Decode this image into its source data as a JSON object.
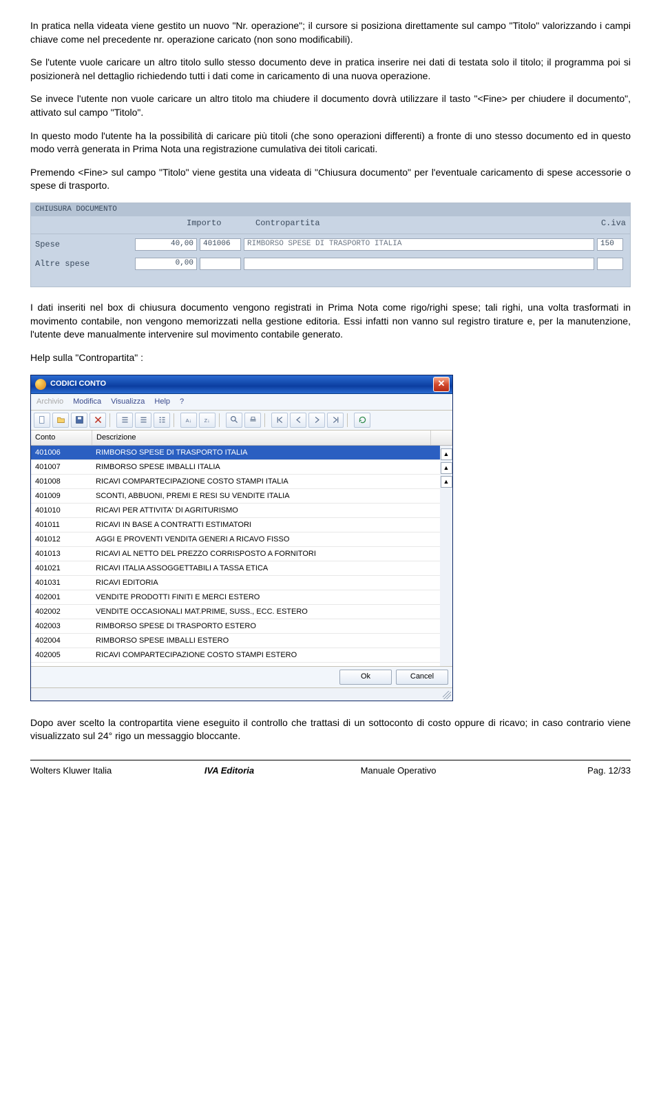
{
  "paragraphs": {
    "p1": "In pratica nella videata viene gestito un nuovo \"Nr. operazione\"; il cursore si posiziona direttamente sul campo \"Titolo\" valorizzando i campi chiave come nel precedente nr. operazione caricato (non sono modificabili).",
    "p2": "Se l'utente vuole caricare un altro titolo sullo stesso documento deve in pratica inserire nei dati di testata solo il titolo; il programma poi si posizionerà nel dettaglio richiedendo tutti i dati come in caricamento di una nuova operazione.",
    "p3": "Se invece l'utente non vuole caricare un altro titolo ma chiudere il documento dovrà utilizzare il tasto \"<Fine> per chiudere il documento\", attivato sul campo \"Titolo\".",
    "p4": "In questo modo l'utente ha la possibilità di caricare più titoli (che sono operazioni differenti) a fronte di uno stesso documento ed in questo modo verrà generata in Prima Nota una registrazione cumulativa dei titoli caricati.",
    "p5": "Premendo <Fine> sul campo \"Titolo\" viene gestita una videata di \"Chiusura documento\" per l'eventuale caricamento di spese accessorie o spese di trasporto.",
    "p6": "I dati inseriti nel box di chiusura documento vengono registrati in Prima Nota come rigo/righi spese; tali righi, una volta trasformati in movimento contabile, non vengono memorizzati nella gestione editoria. Essi infatti non vanno sul registro tirature e, per la manutenzione, l'utente deve manualmente intervenire sul movimento contabile generato.",
    "p7": "Help sulla \"Contropartita\" :",
    "p8": "Dopo aver scelto la contropartita viene eseguito il controllo che trattasi di un sottoconto di costo oppure di ricavo; in caso contrario viene visualizzato sul 24° rigo un messaggio bloccante."
  },
  "chiusura": {
    "title": "CHIUSURA DOCUMENTO",
    "labels": {
      "importo": "Importo",
      "contropartita": "Contropartita",
      "civa": "C.iva"
    },
    "rows": [
      {
        "label": "Spese",
        "importo": "40,00",
        "conto": "401006",
        "desc": "RIMBORSO SPESE DI TRASPORTO ITALIA",
        "civa": "150"
      },
      {
        "label": "Altre spese",
        "importo": "0,00",
        "conto": "",
        "desc": "",
        "civa": ""
      }
    ]
  },
  "codici": {
    "title": "CODICI CONTO",
    "menu": [
      "Archivio",
      "Modifica",
      "Visualizza",
      "Help",
      "?"
    ],
    "columns": {
      "conto": "Conto",
      "desc": "Descrizione"
    },
    "rows": [
      {
        "conto": "401006",
        "desc": "RIMBORSO SPESE DI TRASPORTO ITALIA"
      },
      {
        "conto": "401007",
        "desc": "RIMBORSO SPESE IMBALLI ITALIA"
      },
      {
        "conto": "401008",
        "desc": "RICAVI COMPARTECIPAZIONE COSTO STAMPI ITALIA"
      },
      {
        "conto": "401009",
        "desc": "SCONTI, ABBUONI, PREMI E RESI SU VENDITE ITALIA"
      },
      {
        "conto": "401010",
        "desc": "RICAVI PER ATTIVITA' DI AGRITURISMO"
      },
      {
        "conto": "401011",
        "desc": "RICAVI IN BASE A CONTRATTI ESTIMATORI"
      },
      {
        "conto": "401012",
        "desc": "AGGI E PROVENTI VENDITA GENERI A RICAVO FISSO"
      },
      {
        "conto": "401013",
        "desc": "RICAVI AL NETTO DEL PREZZO CORRISPOSTO A FORNITORI"
      },
      {
        "conto": "401021",
        "desc": "RICAVI ITALIA ASSOGGETTABILI A TASSA ETICA"
      },
      {
        "conto": "401031",
        "desc": "RICAVI EDITORIA"
      },
      {
        "conto": "402001",
        "desc": "VENDITE PRODOTTI FINITI E MERCI ESTERO"
      },
      {
        "conto": "402002",
        "desc": "VENDITE OCCASIONALI MAT.PRIME, SUSS., ECC. ESTERO"
      },
      {
        "conto": "402003",
        "desc": "RIMBORSO SPESE DI TRASPORTO ESTERO"
      },
      {
        "conto": "402004",
        "desc": "RIMBORSO SPESE IMBALLI ESTERO"
      },
      {
        "conto": "402005",
        "desc": "RICAVI COMPARTECIPAZIONE COSTO STAMPI ESTERO"
      }
    ],
    "buttons": {
      "ok": "Ok",
      "cancel": "Cancel"
    }
  },
  "footer": {
    "company": "Wolters Kluwer Italia",
    "product": "IVA Editoria",
    "manual": "Manuale Operativo",
    "page": "Pag.  12/33"
  }
}
